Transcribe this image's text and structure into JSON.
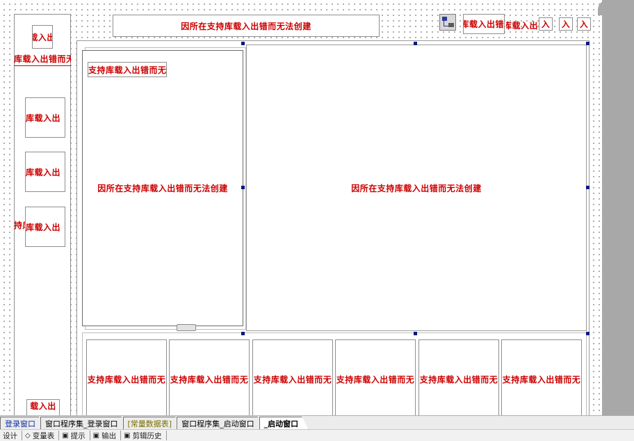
{
  "error_text": "因所在支持库载入出错而无法创建",
  "error_short": {
    "a": "载入出",
    "b": "持库载入出错而",
    "c": "支持库载入出错而无",
    "d": "库载入出错",
    "e": "库载入出",
    "f": "入",
    "g": "库载入出错而无",
    "h": "持库",
    "i": "载入出",
    "j": "库载入出错"
  },
  "tabs": [
    {
      "label": "登录窗口",
      "style": "first"
    },
    {
      "label": "窗口程序集_登录窗口",
      "style": ""
    },
    {
      "label": "[常量数据表]",
      "style": "const"
    },
    {
      "label": "窗口程序集_启动窗口",
      "style": ""
    },
    {
      "label": "_启动窗口",
      "style": "active"
    }
  ],
  "status": [
    {
      "icon": "",
      "label": "设计"
    },
    {
      "icon": "◇",
      "label": "变量表"
    },
    {
      "icon": "▣",
      "label": "提示"
    },
    {
      "icon": "▣",
      "label": "输出"
    },
    {
      "icon": "▣",
      "label": "剪辑历史"
    }
  ],
  "colors": {
    "error": "#cc0000",
    "handle": "#0b1a7a",
    "gray": "#a8a8a8"
  }
}
